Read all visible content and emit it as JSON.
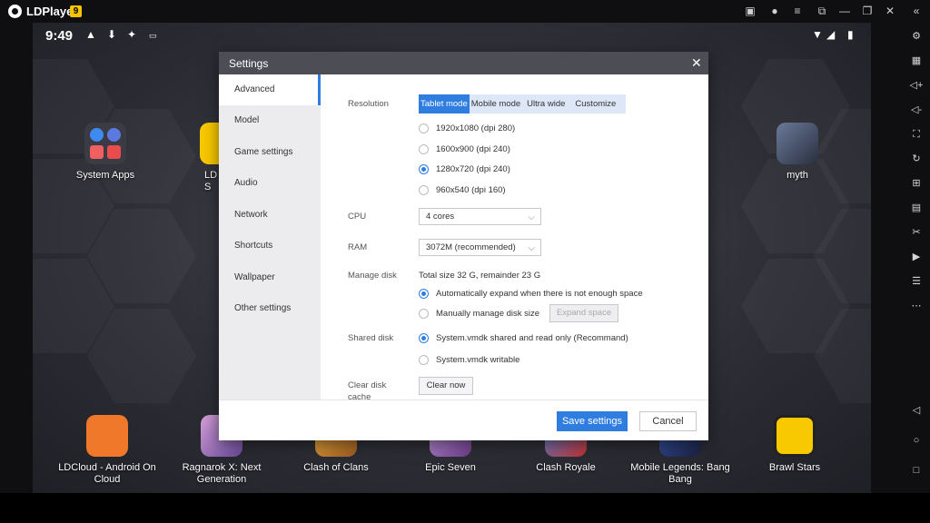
{
  "window": {
    "app_name": "LDPlayer",
    "version_badge": "9"
  },
  "status_bar": {
    "time": "9:49"
  },
  "desktop_apps": {
    "system_apps": "System Apps",
    "ld_store": "LD S",
    "myth": "myth",
    "ldcloud": "LDCloud - Android On Cloud",
    "ragnarok": "Ragnarok X: Next Generation",
    "clash_of_clans": "Clash of Clans",
    "epic_seven": "Epic Seven",
    "clash_royale": "Clash Royale",
    "mobile_legends": "Mobile Legends: Bang Bang",
    "brawl_stars": "Brawl Stars"
  },
  "dialog": {
    "title": "Settings",
    "sidebar": [
      "Advanced",
      "Model",
      "Game settings",
      "Audio",
      "Network",
      "Shortcuts",
      "Wallpaper",
      "Other settings"
    ],
    "resolution": {
      "label": "Resolution",
      "tabs": [
        "Tablet mode",
        "Mobile mode",
        "Ultra wide",
        "Customize"
      ],
      "selected_tab": "Tablet mode",
      "options": [
        "1920x1080  (dpi 280)",
        "1600x900  (dpi 240)",
        "1280x720  (dpi 240)",
        "960x540  (dpi 160)"
      ],
      "selected": "1280x720  (dpi 240)"
    },
    "cpu": {
      "label": "CPU",
      "value": "4 cores"
    },
    "ram": {
      "label": "RAM",
      "value": "3072M (recommended)"
    },
    "manage_disk": {
      "label": "Manage disk",
      "info": "Total size 32 G,  remainder 23 G",
      "auto": "Automatically expand when there is not enough space",
      "manual": "Manually manage disk size",
      "expand_button": "Expand space"
    },
    "shared_disk": {
      "label": "Shared disk",
      "readonly": "System.vmdk shared and read only (Recommand)",
      "writable": "System.vmdk writable"
    },
    "clear_cache": {
      "label": "Clear disk cache",
      "button": "Clear now"
    },
    "save_button": "Save settings",
    "cancel_button": "Cancel"
  },
  "colors": {
    "accent": "#2f7de1",
    "header": "#4d4d56",
    "titlebar": "#0f0f12"
  }
}
